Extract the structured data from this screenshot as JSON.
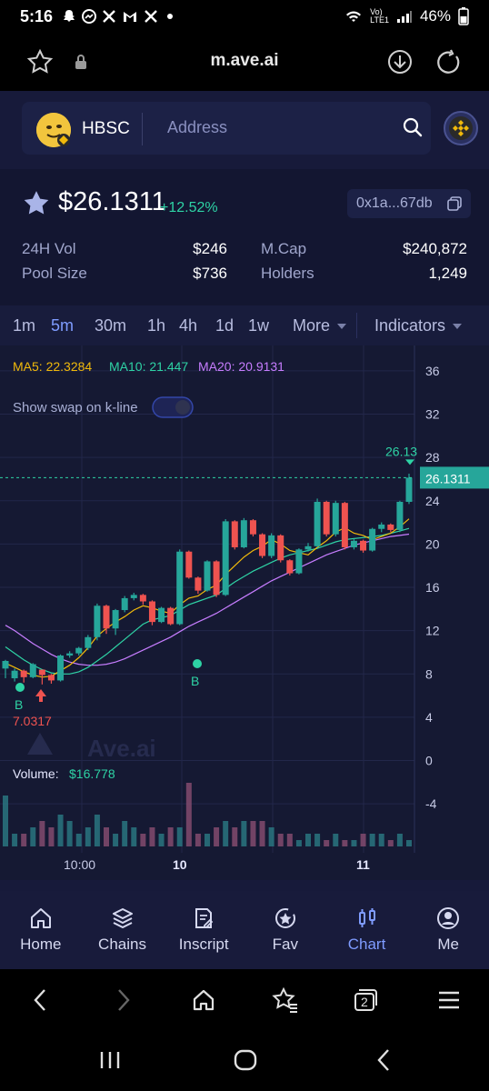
{
  "status_bar": {
    "time": "5:16",
    "battery": "46%",
    "lte": "LTE1",
    "volte": "Vo)"
  },
  "browser": {
    "url": "m.ave.ai",
    "tab_count": "2"
  },
  "search": {
    "token_symbol": "HBSC",
    "placeholder": "Address"
  },
  "token": {
    "price": "$26.1311",
    "change": "+12.52%",
    "address": "0x1a...67db",
    "stats": {
      "vol_label": "24H Vol",
      "vol_value": "$246",
      "pool_label": "Pool Size",
      "pool_value": "$736",
      "mcap_label": "M.Cap",
      "mcap_value": "$240,872",
      "holders_label": "Holders",
      "holders_value": "1,249"
    }
  },
  "timeframes": [
    "1m",
    "5m",
    "30m",
    "1h",
    "4h",
    "1d",
    "1w"
  ],
  "active_timeframe": "5m",
  "timeframe_more": "More",
  "indicators_label": "Indicators",
  "chart": {
    "ma5": "MA5: 22.3284",
    "ma10": "MA10: 21.447",
    "ma20": "MA20: 20.9131",
    "show_swap_label": "Show swap on k-line",
    "current_price_label": "26.1311",
    "current_price_top": "26.13",
    "buy_marker": "B",
    "low_label": "7.0317",
    "volume_label": "Volume:",
    "volume_value": "$16.778",
    "watermark": "Ave.ai",
    "x_labels": [
      "10:00",
      "10",
      "11"
    ],
    "colors": {
      "up": "#26a69a",
      "down": "#ef5350",
      "ma5": "#f0b90b",
      "ma10": "#2ed3a5",
      "ma20": "#c77dff"
    }
  },
  "chart_data": {
    "type": "candlestick",
    "y_ticks": [
      36,
      32,
      28,
      24,
      20,
      16,
      12,
      8,
      4,
      0,
      -4
    ],
    "ylim": [
      -5.5,
      37
    ],
    "candles": [
      [
        8.5,
        9.2,
        7.8,
        7.6,
        9.3
      ],
      [
        7.6,
        8.3,
        7.4,
        7.3,
        8.5
      ],
      [
        8.3,
        7.7,
        7.3,
        7.2,
        8.4
      ],
      [
        7.7,
        8.9,
        7.8,
        7.6,
        9.0
      ],
      [
        8.4,
        7.9,
        7.1,
        7.03,
        8.4
      ],
      [
        7.9,
        7.4,
        7.2,
        7.1,
        8.0
      ],
      [
        7.4,
        9.7,
        7.7,
        7.3,
        9.8
      ],
      [
        9.7,
        9.9,
        9.6,
        9.5,
        10.1
      ],
      [
        9.9,
        10.4,
        9.8,
        9.7,
        10.5
      ],
      [
        10.4,
        11.4,
        10.3,
        10.2,
        11.6
      ],
      [
        11.4,
        14.3,
        11.3,
        11.1,
        14.5
      ],
      [
        14.3,
        12.2,
        11.8,
        11.7,
        14.4
      ],
      [
        12.2,
        13.9,
        11.7,
        11.6,
        14.0
      ],
      [
        13.9,
        15.0,
        13.8,
        13.7,
        15.2
      ],
      [
        15.0,
        15.3,
        14.9,
        14.8,
        15.5
      ],
      [
        15.3,
        14.7,
        14.5,
        14.4,
        15.4
      ],
      [
        14.7,
        12.8,
        12.6,
        12.5,
        14.8
      ],
      [
        12.8,
        14.1,
        12.9,
        12.7,
        14.2
      ],
      [
        14.1,
        12.6,
        13.0,
        12.5,
        14.2
      ],
      [
        12.6,
        19.3,
        12.7,
        12.5,
        19.5
      ],
      [
        19.3,
        16.9,
        17.0,
        16.8,
        19.4
      ],
      [
        16.9,
        15.7,
        15.5,
        15.4,
        17.0
      ],
      [
        15.7,
        18.4,
        15.8,
        15.6,
        18.5
      ],
      [
        18.4,
        15.3,
        15.2,
        15.1,
        18.5
      ],
      [
        15.3,
        22.1,
        15.4,
        15.2,
        22.3
      ],
      [
        22.1,
        19.7,
        19.6,
        19.5,
        22.2
      ],
      [
        19.7,
        22.2,
        19.8,
        19.6,
        22.4
      ],
      [
        22.2,
        20.9,
        20.8,
        20.7,
        22.3
      ],
      [
        20.9,
        18.9,
        18.8,
        18.7,
        21.0
      ],
      [
        18.9,
        20.8,
        18.8,
        18.7,
        21.0
      ],
      [
        20.8,
        18.5,
        18.4,
        18.3,
        20.9
      ],
      [
        18.5,
        17.3,
        17.2,
        17.1,
        18.6
      ],
      [
        17.3,
        19.5,
        17.4,
        17.2,
        19.6
      ],
      [
        19.5,
        19.8,
        19.4,
        19.3,
        20.1
      ],
      [
        19.8,
        23.9,
        19.9,
        19.7,
        24.2
      ],
      [
        23.9,
        20.9,
        20.8,
        20.7,
        24.0
      ],
      [
        20.9,
        23.8,
        20.8,
        20.7,
        24.0
      ],
      [
        23.8,
        19.7,
        19.6,
        19.5,
        23.9
      ],
      [
        19.7,
        20.3,
        19.6,
        19.5,
        20.5
      ],
      [
        20.3,
        19.4,
        19.3,
        19.2,
        20.4
      ],
      [
        19.4,
        21.4,
        19.5,
        19.3,
        21.5
      ],
      [
        21.4,
        21.8,
        21.2,
        21.1,
        22.0
      ],
      [
        21.8,
        21.3,
        21.2,
        21.1,
        21.9
      ],
      [
        21.3,
        23.9,
        21.2,
        21.1,
        24.0
      ],
      [
        23.9,
        26.1311,
        23.8,
        23.7,
        26.5
      ]
    ],
    "ma5": [
      9.0,
      8.6,
      8.2,
      7.9,
      7.7,
      7.8,
      8.3,
      8.8,
      9.5,
      10.4,
      11.5,
      12.2,
      12.8,
      13.3,
      13.9,
      14.3,
      14.1,
      13.8,
      13.6,
      14.4,
      15.0,
      15.2,
      15.8,
      16.2,
      17.2,
      18.0,
      18.8,
      19.4,
      19.8,
      20.4,
      20.0,
      19.4,
      19.2,
      19.0,
      19.7,
      20.3,
      21.1,
      21.5,
      21.0,
      20.8,
      20.4,
      20.7,
      21.0,
      21.6,
      22.3284
    ],
    "ma10": [
      10.5,
      9.9,
      9.3,
      8.8,
      8.4,
      8.1,
      8.0,
      8.0,
      8.2,
      8.6,
      9.2,
      9.8,
      10.5,
      11.2,
      11.9,
      12.6,
      13.0,
      13.2,
      13.4,
      13.9,
      14.4,
      14.7,
      15.0,
      15.3,
      15.9,
      16.5,
      17.0,
      17.5,
      17.9,
      18.3,
      18.7,
      19.0,
      19.2,
      19.4,
      19.6,
      19.9,
      20.2,
      20.4,
      20.5,
      20.6,
      20.7,
      20.8,
      21.0,
      21.2,
      21.447
    ],
    "ma20": [
      12.5,
      12.0,
      11.4,
      10.8,
      10.3,
      9.8,
      9.4,
      9.1,
      8.9,
      8.8,
      8.8,
      8.9,
      9.1,
      9.4,
      9.8,
      10.2,
      10.6,
      11.0,
      11.4,
      11.9,
      12.4,
      12.8,
      13.2,
      13.6,
      14.1,
      14.6,
      15.1,
      15.6,
      16.1,
      16.6,
      17.0,
      17.4,
      17.8,
      18.2,
      18.6,
      19.0,
      19.3,
      19.6,
      19.9,
      20.1,
      20.3,
      20.5,
      20.7,
      20.8,
      20.9131
    ],
    "volume": [
      8,
      2,
      2,
      3,
      4,
      3,
      5,
      4,
      2,
      3,
      5,
      3,
      2,
      4,
      3,
      2,
      3,
      2,
      3,
      3,
      10,
      2,
      2,
      3,
      4,
      3,
      4,
      4,
      4,
      3,
      2,
      2,
      1,
      2,
      2,
      1,
      2,
      1,
      1,
      2,
      2,
      2,
      1,
      2,
      1
    ],
    "price_line": 26.1311
  },
  "bottom_nav": [
    {
      "label": "Home",
      "icon": "home-icon"
    },
    {
      "label": "Chains",
      "icon": "chains-icon"
    },
    {
      "label": "Inscript",
      "icon": "inscript-icon"
    },
    {
      "label": "Fav",
      "icon": "fav-icon"
    },
    {
      "label": "Chart",
      "icon": "chart-icon"
    },
    {
      "label": "Me",
      "icon": "me-icon"
    }
  ],
  "active_nav": "Chart"
}
